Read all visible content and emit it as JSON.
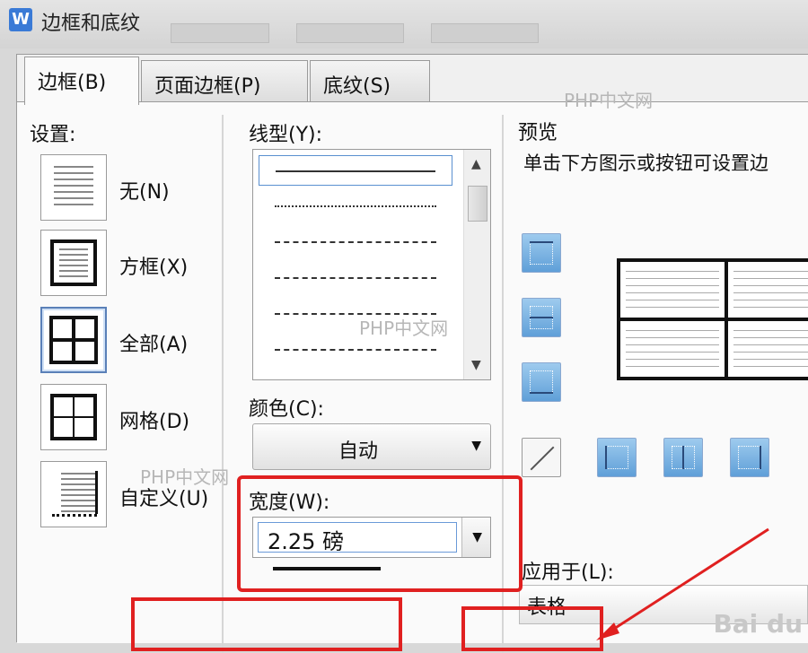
{
  "window": {
    "title": "边框和底纹",
    "app_icon_letter": "W"
  },
  "tabs": [
    {
      "label": "边框(B)",
      "active": true
    },
    {
      "label": "页面边框(P)",
      "active": false
    },
    {
      "label": "底纹(S)",
      "active": false
    }
  ],
  "settings": {
    "heading": "设置:",
    "items": [
      {
        "label": "无(N)",
        "selected": false
      },
      {
        "label": "方框(X)",
        "selected": false
      },
      {
        "label": "全部(A)",
        "selected": true
      },
      {
        "label": "网格(D)",
        "selected": false
      },
      {
        "label": "自定义(U)",
        "selected": false
      }
    ]
  },
  "line_style": {
    "heading": "线型(Y):"
  },
  "color": {
    "heading": "颜色(C):",
    "value": "自动"
  },
  "width": {
    "heading": "宽度(W):",
    "value": "2.25 磅"
  },
  "preview": {
    "heading": "预览",
    "hint": "单击下方图示或按钮可设置边"
  },
  "apply_to": {
    "heading": "应用于(L):",
    "value": "表格"
  },
  "watermarks": {
    "php": "PHP中文网",
    "baidu": "Bai du"
  },
  "colors": {
    "accent_red": "#e02020",
    "button_blue": "#5f9fd8",
    "select_border": "#5a90d0"
  }
}
